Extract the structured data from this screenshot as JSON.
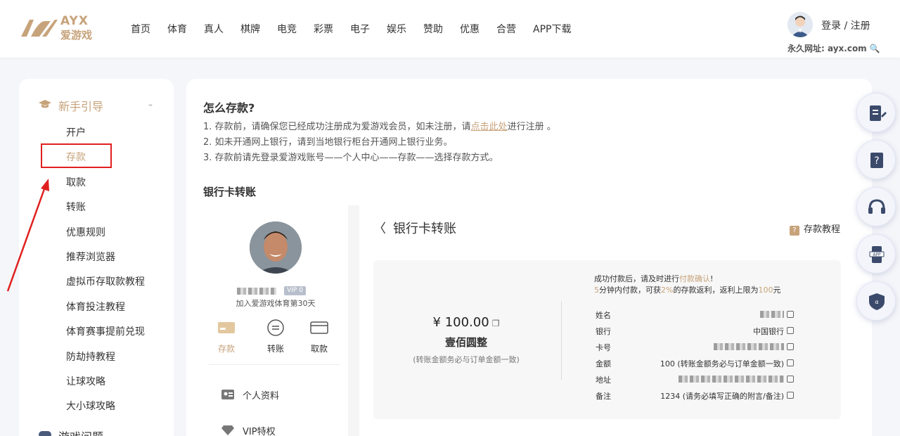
{
  "header": {
    "logo_top": "AYX",
    "logo_bottom": "爱游戏",
    "nav": [
      "首页",
      "体育",
      "真人",
      "棋牌",
      "电竞",
      "彩票",
      "电子",
      "娱乐",
      "赞助",
      "优惠",
      "合营",
      "APP下载"
    ],
    "login": "登录 / 注册",
    "permanent_url": "永久网址: ayx.com"
  },
  "sidebar": {
    "section_title": "新手引导",
    "items": [
      "开户",
      "存款",
      "取款",
      "转账",
      "优惠规则",
      "推荐浏览器",
      "虚拟币存取款教程",
      "体育投注教程",
      "体育赛事提前兑现",
      "防劫持教程",
      "让球攻略",
      "大小球攻略"
    ],
    "active_index": 1,
    "section2_title": "游戏问题"
  },
  "main": {
    "title": "怎么存款?",
    "steps": {
      "s1_pre": "1. 存款前，请确保您已经成功注册成为爱游戏会员，如未注册，请",
      "s1_link": "点击此处",
      "s1_post": "进行注册 。",
      "s2": "2. 如未开通网上银行，请到当地银行柜台开通网上银行业务。",
      "s3": "3. 存款前请先登录爱游戏账号——个人中心——存款——选择存款方式。"
    },
    "subtitle": "银行卡转账"
  },
  "mock": {
    "vip": "VIP 0",
    "join": "加入爱游戏体育第30天",
    "ops": [
      "存款",
      "转账",
      "取款"
    ],
    "menu": [
      "个人资料",
      "VIP特权"
    ]
  },
  "card": {
    "title": "银行卡转账",
    "tutorial": "存款教程",
    "amount": "¥ 100.00",
    "amount_cn": "壹佰圆整",
    "amount_note": "(转账金额务必与订单金额一致)",
    "tip1_pre": "成功付款后，请及时进行",
    "tip1_link": "付款确认",
    "tip1_post": "!",
    "tip2_a": "5",
    "tip2_b": "分钟内付款，可获",
    "tip2_c": "2%",
    "tip2_d": "的存款返利，返利上限为",
    "tip2_e": "100",
    "tip2_f": "元",
    "fields": [
      {
        "key": "姓名",
        "value": ""
      },
      {
        "key": "银行",
        "value": "中国银行"
      },
      {
        "key": "卡号",
        "value": ""
      },
      {
        "key": "金额",
        "value": "100 (转账金额务必与订单金额一致)"
      },
      {
        "key": "地址",
        "value": ""
      },
      {
        "key": "备注",
        "value": "1234 (请务必填写正确的附言/备注)"
      }
    ]
  },
  "floating": [
    "edit-icon",
    "help-book-icon",
    "headset-icon",
    "app-icon",
    "shield-icon"
  ]
}
